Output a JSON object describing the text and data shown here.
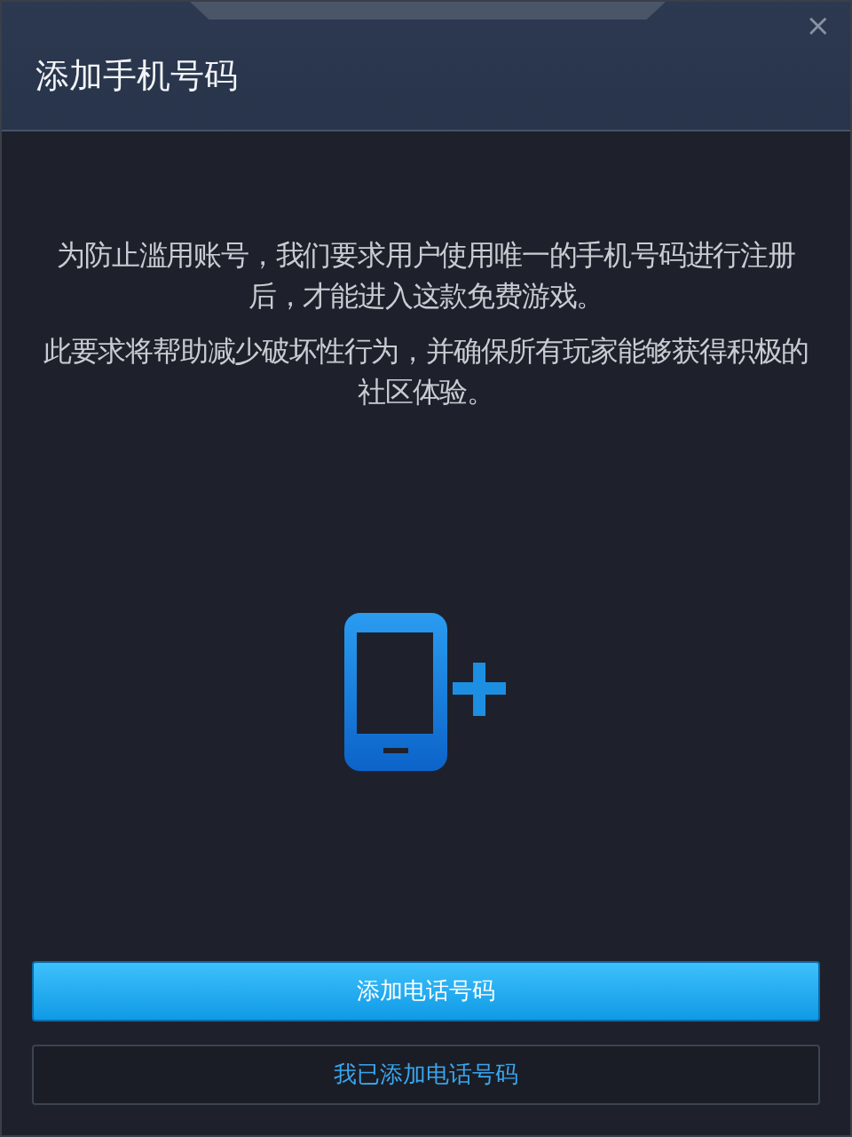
{
  "window": {
    "title": "添加手机号码",
    "close": "×"
  },
  "paragraphs": [
    "为防止滥用账号，我们要求用户使用唯一的手机号码进行注册后，才能进入这款免费游戏。",
    "此要求将帮助减少破坏性行为，并确保所有玩家能够获得积极的社区体验。"
  ],
  "buttons": [
    {
      "kind": "primary",
      "label": "添加电话号码"
    },
    {
      "kind": "secondary",
      "label": "我已添加电话号码"
    }
  ]
}
